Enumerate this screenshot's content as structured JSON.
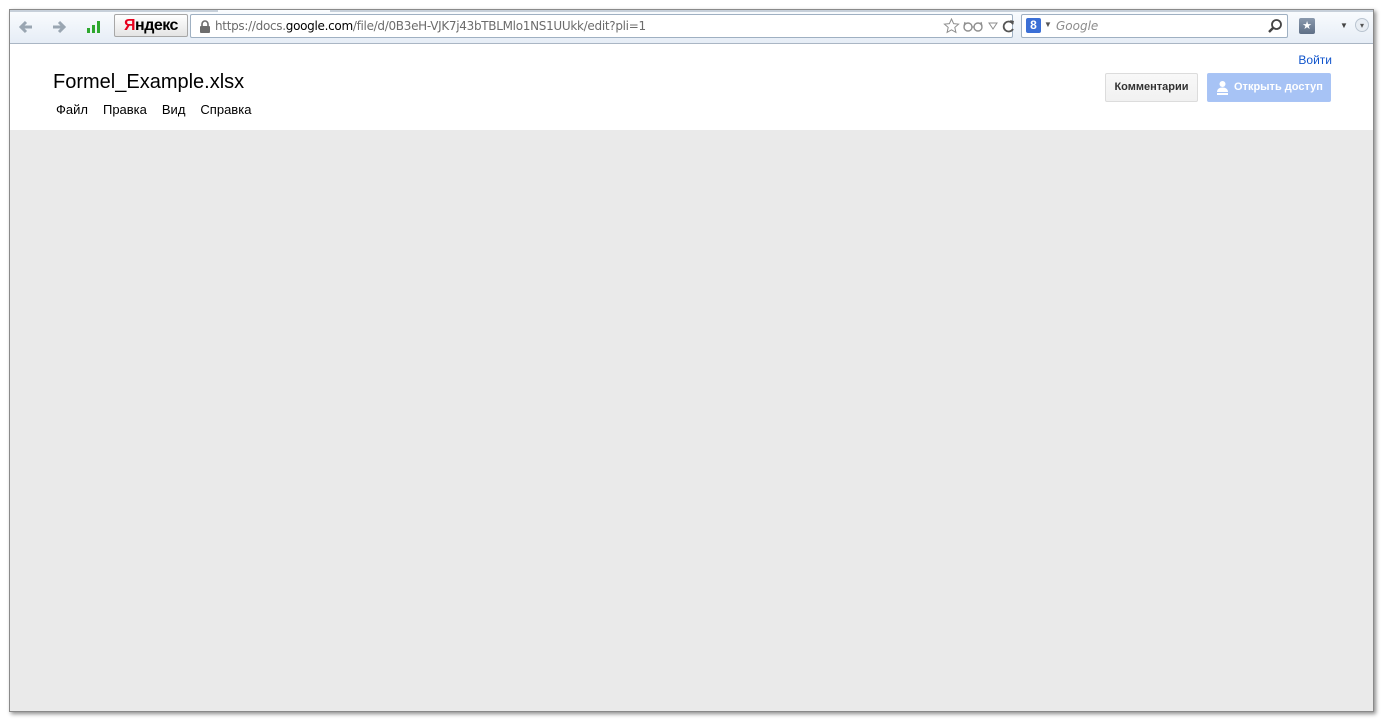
{
  "browser": {
    "yandex_button": {
      "first": "Я",
      "rest": "ндекс"
    },
    "address": {
      "scheme": "https://",
      "host_prefix": "docs.",
      "host_main": "google.com",
      "path": "/file/d/0B3eH-VJK7j43bTBLMlo1NS1UUkk/edit?pli=1"
    },
    "search": {
      "placeholder": "Google",
      "engine_badge": "8"
    }
  },
  "docs": {
    "title": "Formel_Example.xlsx",
    "menu": [
      "Файл",
      "Правка",
      "Вид",
      "Справка"
    ],
    "signin": "Войти",
    "comments_button": "Комментарии",
    "share_button": "Открыть доступ"
  },
  "colors": {
    "accent": "#1155cc",
    "share_button_bg": "#a7c3f5",
    "content_bg": "#eaeaea"
  },
  "icons": [
    "back-arrow-icon",
    "forward-arrow-icon",
    "signal-bars-icon",
    "lock-icon",
    "star-icon",
    "reader-glasses-icon",
    "dropdown-triangle-icon",
    "reload-icon",
    "google-icon",
    "magnifier-icon",
    "bookmarks-icon",
    "menu-caret-icon",
    "share-person-icon"
  ]
}
